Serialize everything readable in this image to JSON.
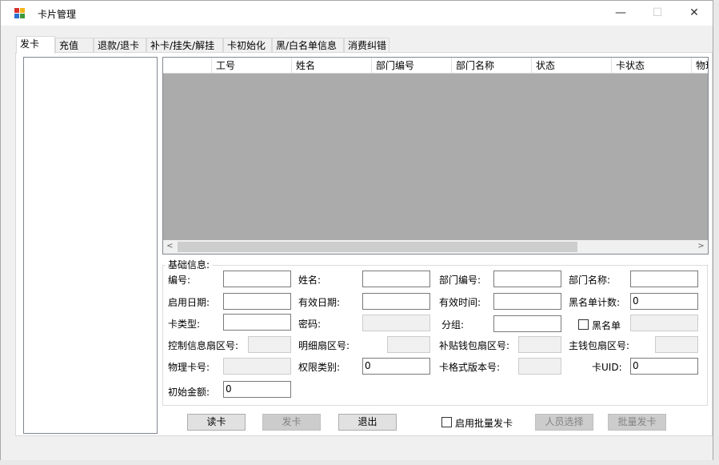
{
  "window": {
    "title": "卡片管理",
    "minimize_glyph": "—",
    "maximize_glyph": "☐",
    "close_glyph": "✕"
  },
  "tabs": [
    "发卡",
    "充值",
    "退款/退卡",
    "补卡/挂失/解挂",
    "卡初始化",
    "黑/白名单信息",
    "消费纠错"
  ],
  "grid": {
    "columns": [
      "",
      "工号",
      "姓名",
      "部门编号",
      "部门名称",
      "状态",
      "卡状态",
      "物理"
    ],
    "scroll_left": "<",
    "scroll_right": ">"
  },
  "basic_info": {
    "title": "基础信息:",
    "labels": {
      "number": "编号:",
      "name": "姓名:",
      "dept_no": "部门编号:",
      "dept_name": "部门名称:",
      "start_date": "启用日期:",
      "valid_date": "有效日期:",
      "valid_time": "有效时间:",
      "blacklist_count": "黑名单计数:",
      "card_type": "卡类型:",
      "password": "密码:",
      "group": "分组:",
      "blacklist": "黑名单",
      "ctrl_sector": "控制信息扇区号:",
      "detail_sector": "明细扇区号:",
      "subsidy_sector": "补贴钱包扇区号:",
      "main_sector": "主钱包扇区号:",
      "physical_no": "物理卡号:",
      "permission": "权限类别:",
      "format_version": "卡格式版本号:",
      "card_uid": "卡UID:",
      "initial_amount": "初始金额:"
    },
    "values": {
      "blacklist_count": "0",
      "permission": "0",
      "card_uid": "0",
      "initial_amount": "0"
    }
  },
  "buttons": {
    "read_card": "读卡",
    "issue_card": "发卡",
    "exit": "退出",
    "batch_enable": "启用批量发卡",
    "select_person": "人员选择",
    "batch_issue": "批量发卡"
  }
}
